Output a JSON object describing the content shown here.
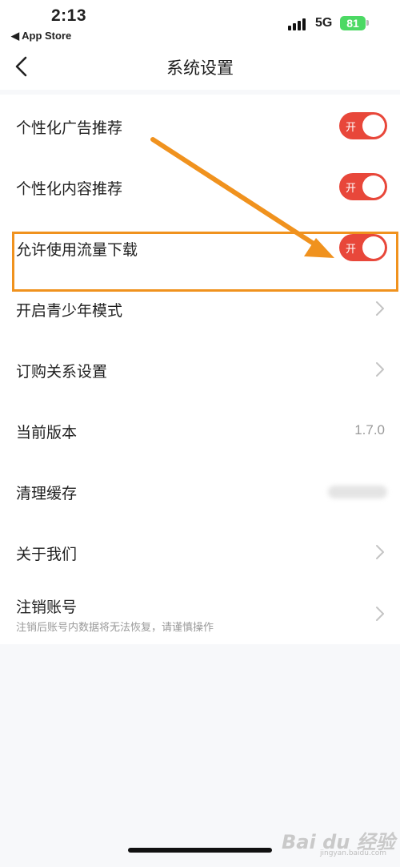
{
  "status_bar": {
    "time": "2:13",
    "back_app": "◀ App Store",
    "network": "5G",
    "battery": "81"
  },
  "nav": {
    "title": "系统设置"
  },
  "settings": [
    {
      "label": "个性化广告推荐",
      "control": "toggle",
      "toggle_text": "开",
      "on": true
    },
    {
      "label": "个性化内容推荐",
      "control": "toggle",
      "toggle_text": "开",
      "on": true
    },
    {
      "label": "允许使用流量下载",
      "control": "toggle",
      "toggle_text": "开",
      "on": true
    },
    {
      "label": "开启青少年模式",
      "control": "chevron"
    },
    {
      "label": "订购关系设置",
      "control": "chevron"
    },
    {
      "label": "当前版本",
      "control": "value",
      "value": "1.7.0"
    },
    {
      "label": "清理缓存",
      "control": "blurred-value"
    },
    {
      "label": "关于我们",
      "control": "chevron"
    },
    {
      "label": "注销账号",
      "sublabel": "注销后账号内数据将无法恢复，请谨慎操作",
      "control": "chevron"
    }
  ],
  "annotation": {
    "color": "#f0921e",
    "highlighted_row": "允许使用流量下载"
  },
  "watermark": {
    "text": "Bai du 经验",
    "sub": "jingyan.baidu.com"
  },
  "colors": {
    "toggle_on": "#e8473a",
    "battery": "#4cd964",
    "background": "#f7f8fa"
  }
}
